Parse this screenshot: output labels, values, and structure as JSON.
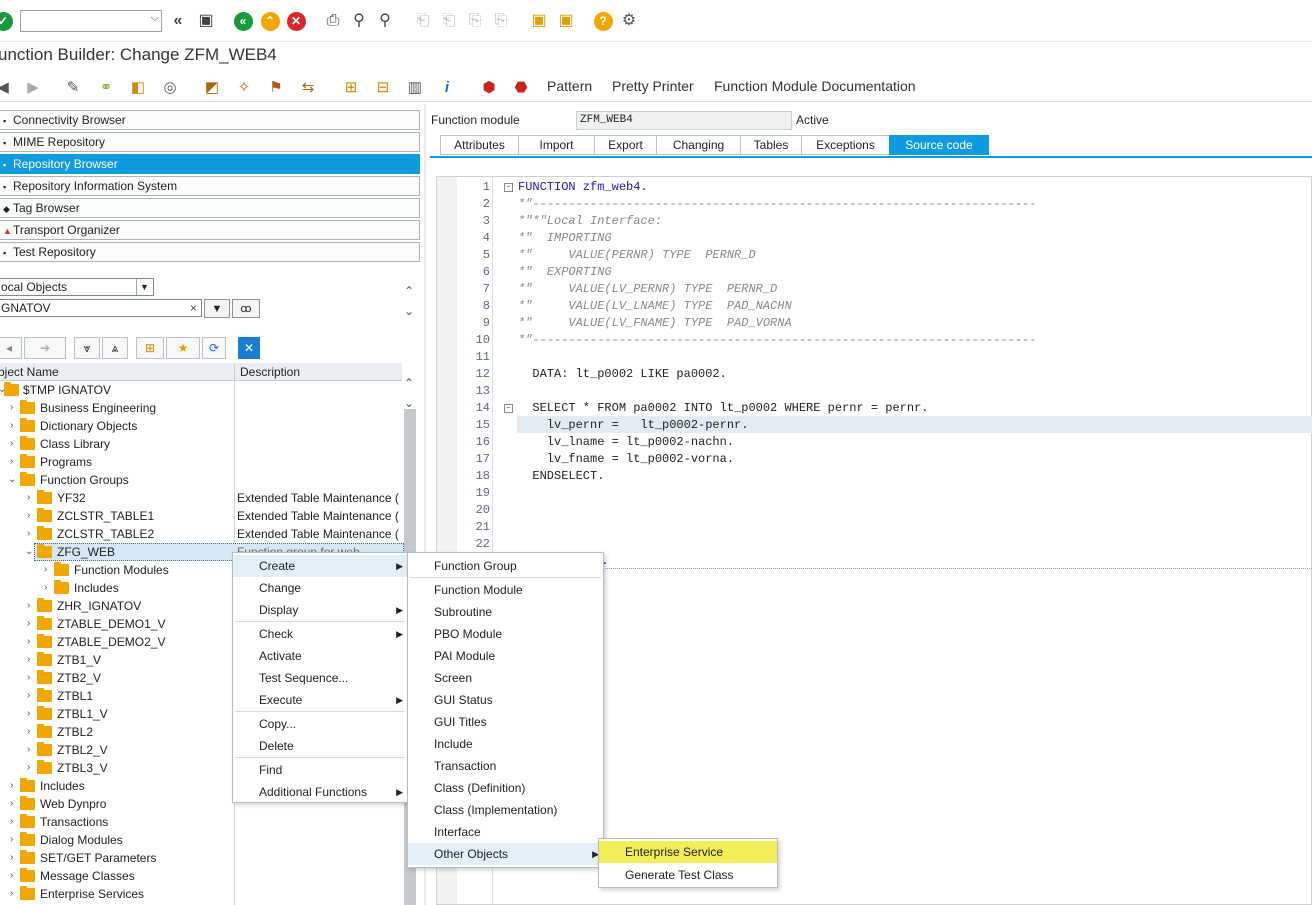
{
  "header": {
    "title": "unction Builder: Change ZFM_WEB4",
    "okcode_value": ""
  },
  "app_toolbar": {
    "pattern_label": "Pattern",
    "pretty_printer_label": "Pretty Printer",
    "fm_doc_label": "Function Module Documentation"
  },
  "nav": {
    "items": [
      {
        "label": "Connectivity Browser",
        "icon": "connectivity-icon"
      },
      {
        "label": "MIME Repository",
        "icon": "mime-icon"
      },
      {
        "label": "Repository Browser",
        "icon": "repository-icon",
        "selected": true
      },
      {
        "label": "Repository Information System",
        "icon": "info-system-icon"
      },
      {
        "label": "Tag Browser",
        "icon": "tag-icon"
      },
      {
        "label": "Transport Organizer",
        "icon": "transport-icon"
      },
      {
        "label": "Test Repository",
        "icon": "test-icon"
      }
    ]
  },
  "object_selector": {
    "type_value": "ocal Objects",
    "name_value": "GNATOV"
  },
  "tree": {
    "col_name": "bject Name",
    "col_desc": "Description",
    "root": "$TMP IGNATOV",
    "rows": [
      {
        "label": "Business Engineering",
        "desc": ""
      },
      {
        "label": "Dictionary Objects",
        "desc": ""
      },
      {
        "label": "Class Library",
        "desc": ""
      },
      {
        "label": "Programs",
        "desc": ""
      },
      {
        "label": "Function Groups",
        "desc": ""
      },
      {
        "label": "YF32",
        "desc": "Extended Table Maintenance ("
      },
      {
        "label": "ZCLSTR_TABLE1",
        "desc": "Extended Table Maintenance ("
      },
      {
        "label": "ZCLSTR_TABLE2",
        "desc": "Extended Table Maintenance ("
      },
      {
        "label": "ZFG_WEB",
        "desc": "Function group for web"
      },
      {
        "label": "Function Modules",
        "desc": ""
      },
      {
        "label": "Includes",
        "desc": ""
      },
      {
        "label": "ZHR_IGNATOV",
        "desc": ""
      },
      {
        "label": "ZTABLE_DEMO1_V",
        "desc": ""
      },
      {
        "label": "ZTABLE_DEMO2_V",
        "desc": ""
      },
      {
        "label": "ZTB1_V",
        "desc": ""
      },
      {
        "label": "ZTB2_V",
        "desc": ""
      },
      {
        "label": "ZTBL1",
        "desc": ""
      },
      {
        "label": "ZTBL1_V",
        "desc": ""
      },
      {
        "label": "ZTBL2",
        "desc": ""
      },
      {
        "label": "ZTBL2_V",
        "desc": ""
      },
      {
        "label": "ZTBL3_V",
        "desc": ""
      },
      {
        "label": "Includes",
        "desc": ""
      },
      {
        "label": "Web Dynpro",
        "desc": ""
      },
      {
        "label": "Transactions",
        "desc": ""
      },
      {
        "label": "Dialog Modules",
        "desc": ""
      },
      {
        "label": "SET/GET Parameters",
        "desc": ""
      },
      {
        "label": "Message Classes",
        "desc": ""
      },
      {
        "label": "Enterprise Services",
        "desc": ""
      }
    ]
  },
  "function_module": {
    "label": "Function module",
    "value": "ZFM_WEB4",
    "status": "Active"
  },
  "tabs": [
    "Attributes",
    "Import",
    "Export",
    "Changing",
    "Tables",
    "Exceptions",
    "Source code"
  ],
  "code": {
    "lines": [
      {
        "n": "1",
        "text": "FUNCTION zfm_web4."
      },
      {
        "n": "2",
        "text": "*\"----------------------------------------------------------------------"
      },
      {
        "n": "3",
        "text": "*\"*\"Local Interface:"
      },
      {
        "n": "4",
        "text": "*\"  IMPORTING"
      },
      {
        "n": "5",
        "text": "*\"     VALUE(PERNR) TYPE  PERNR_D"
      },
      {
        "n": "6",
        "text": "*\"  EXPORTING"
      },
      {
        "n": "7",
        "text": "*\"     VALUE(LV_PERNR) TYPE  PERNR_D"
      },
      {
        "n": "8",
        "text": "*\"     VALUE(LV_LNAME) TYPE  PAD_NACHN"
      },
      {
        "n": "9",
        "text": "*\"     VALUE(LV_FNAME) TYPE  PAD_VORNA"
      },
      {
        "n": "10",
        "text": "*\"----------------------------------------------------------------------"
      },
      {
        "n": "11",
        "text": ""
      },
      {
        "n": "12",
        "text": "  DATA: lt_p0002 LIKE pa0002."
      },
      {
        "n": "13",
        "text": ""
      },
      {
        "n": "14",
        "text": "  SELECT * FROM pa0002 INTO lt_p0002 WHERE pernr = pernr."
      },
      {
        "n": "15",
        "text": "    lv_pernr =   lt_p0002-pernr."
      },
      {
        "n": "16",
        "text": "    lv_lname = lt_p0002-nachn."
      },
      {
        "n": "17",
        "text": "    lv_fname = lt_p0002-vorna."
      },
      {
        "n": "18",
        "text": "  ENDSELECT."
      },
      {
        "n": "19",
        "text": ""
      },
      {
        "n": "20",
        "text": ""
      },
      {
        "n": "21",
        "text": ""
      },
      {
        "n": "22",
        "text": ""
      }
    ],
    "tail_fragment": "N."
  },
  "context_menu": {
    "items": [
      "Create",
      "Change",
      "Display",
      "Check",
      "Activate",
      "Test Sequence...",
      "Execute",
      "Copy...",
      "Delete",
      "Find",
      "Additional Functions"
    ]
  },
  "create_menu": {
    "items": [
      "Function Group",
      "Function Module",
      "Subroutine",
      "PBO Module",
      "PAI Module",
      "Screen",
      "GUI Status",
      "GUI Titles",
      "Include",
      "Transaction",
      "Class (Definition)",
      "Class (Implementation)",
      "Interface",
      "Other Objects"
    ]
  },
  "other_menu": {
    "items": [
      "Enterprise Service",
      "Generate Test Class"
    ]
  },
  "colors": {
    "accent": "#0e9be0",
    "folder": "#f0a800",
    "highlight_yellow": "#f1ee58"
  }
}
